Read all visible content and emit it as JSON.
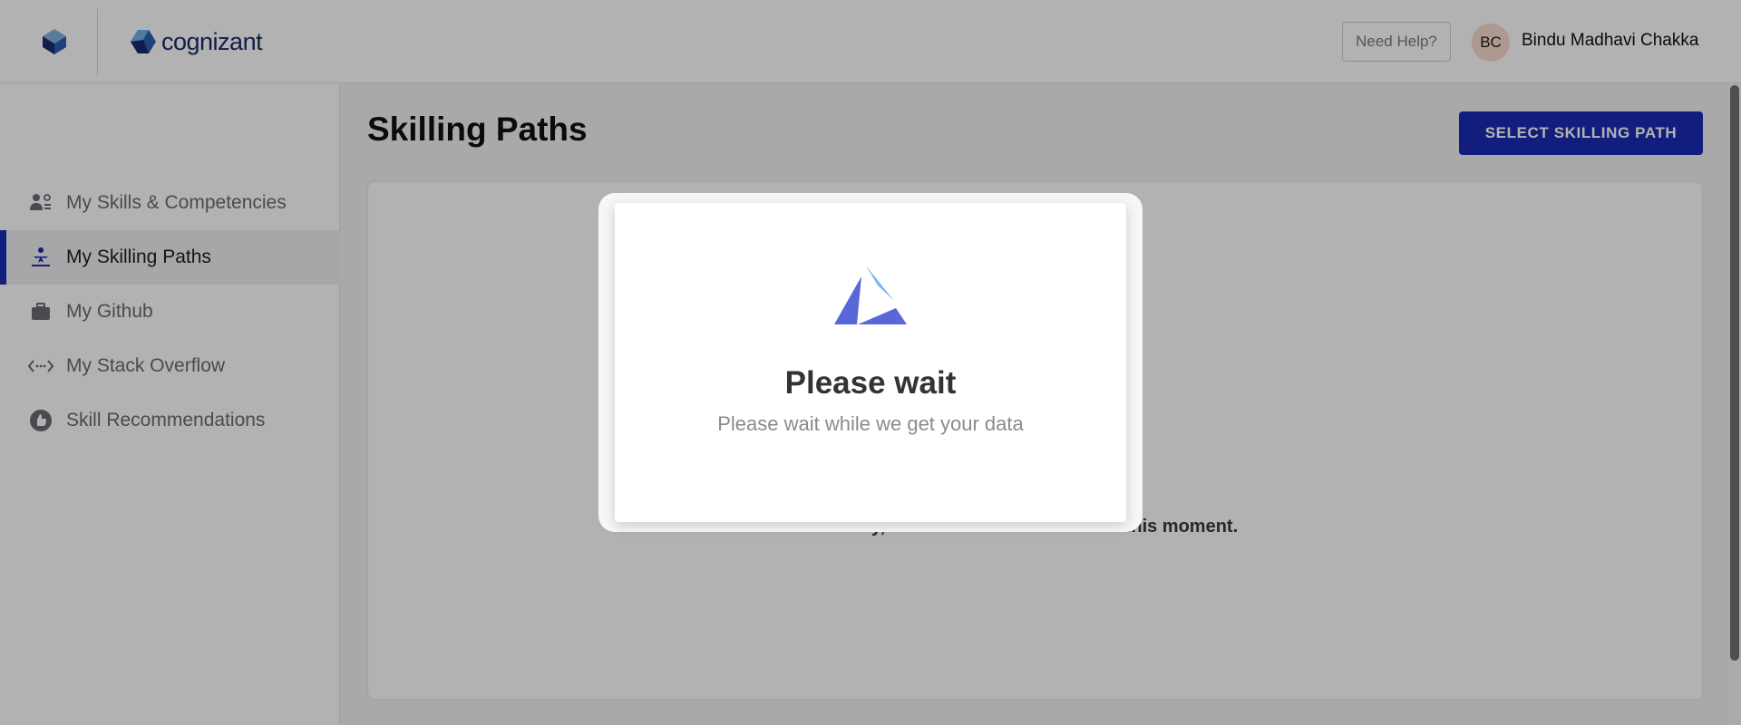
{
  "header": {
    "brand_name": "cognizant",
    "help_label": "Need Help?",
    "user_initials": "BC",
    "user_name": "Bindu Madhavi Chakka"
  },
  "sidebar": {
    "items": [
      {
        "label": "My Skills & Competencies",
        "icon": "people-skills-icon",
        "active": false
      },
      {
        "label": "My Skilling Paths",
        "icon": "person-path-icon",
        "active": true
      },
      {
        "label": "My Github",
        "icon": "briefcase-icon",
        "active": false
      },
      {
        "label": "My Stack Overflow",
        "icon": "code-arrows-icon",
        "active": false
      },
      {
        "label": "Skill Recommendations",
        "icon": "thumbs-up-icon",
        "active": false
      }
    ]
  },
  "main": {
    "title": "Skilling Paths",
    "primary_action": "SELECT SKILLING PATH",
    "empty_message": "Sorry, there are no items listed at this moment."
  },
  "modal": {
    "title": "Please wait",
    "subtitle": "Please wait while we get your data",
    "logo": "triangle-logo-icon"
  },
  "colors": {
    "accent": "#1a2bb5",
    "brand": "#1a2a6c",
    "logo_dark": "#5a67d8",
    "logo_light": "#7ab4ef"
  }
}
